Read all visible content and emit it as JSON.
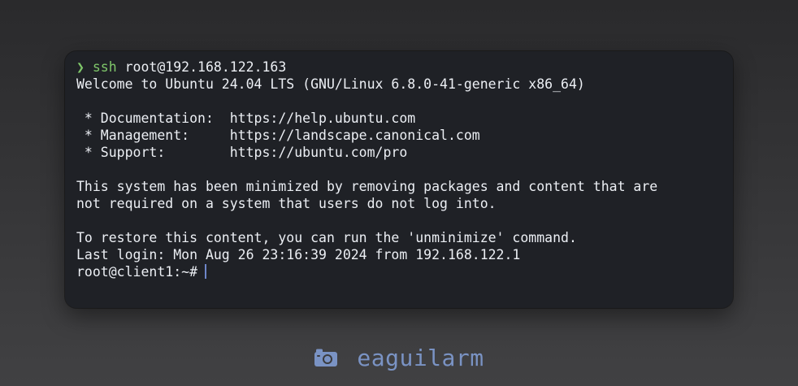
{
  "terminal": {
    "prompt": {
      "glyph": "❯",
      "command": "ssh",
      "argument": "root@192.168.122.163"
    },
    "lines": [
      "Welcome to Ubuntu 24.04 LTS (GNU/Linux 6.8.0-41-generic x86_64)",
      "",
      " * Documentation:  https://help.ubuntu.com",
      " * Management:     https://landscape.canonical.com",
      " * Support:        https://ubuntu.com/pro",
      "",
      "This system has been minimized by removing packages and content that are",
      "not required on a system that users do not log into.",
      "",
      "To restore this content, you can run the 'unminimize' command.",
      "Last login: Mon Aug 26 23:16:39 2024 from 192.168.122.1"
    ],
    "shell_prompt": "root@client1:~#"
  },
  "footer": {
    "icon": "camera-icon",
    "handle": "eaguilarm"
  },
  "colors": {
    "terminal_bg": "#1f2126",
    "text": "#eceff4",
    "prompt_green": "#7fc76a",
    "accent_blue": "#7a93c4",
    "cursor": "#6e86c9"
  }
}
